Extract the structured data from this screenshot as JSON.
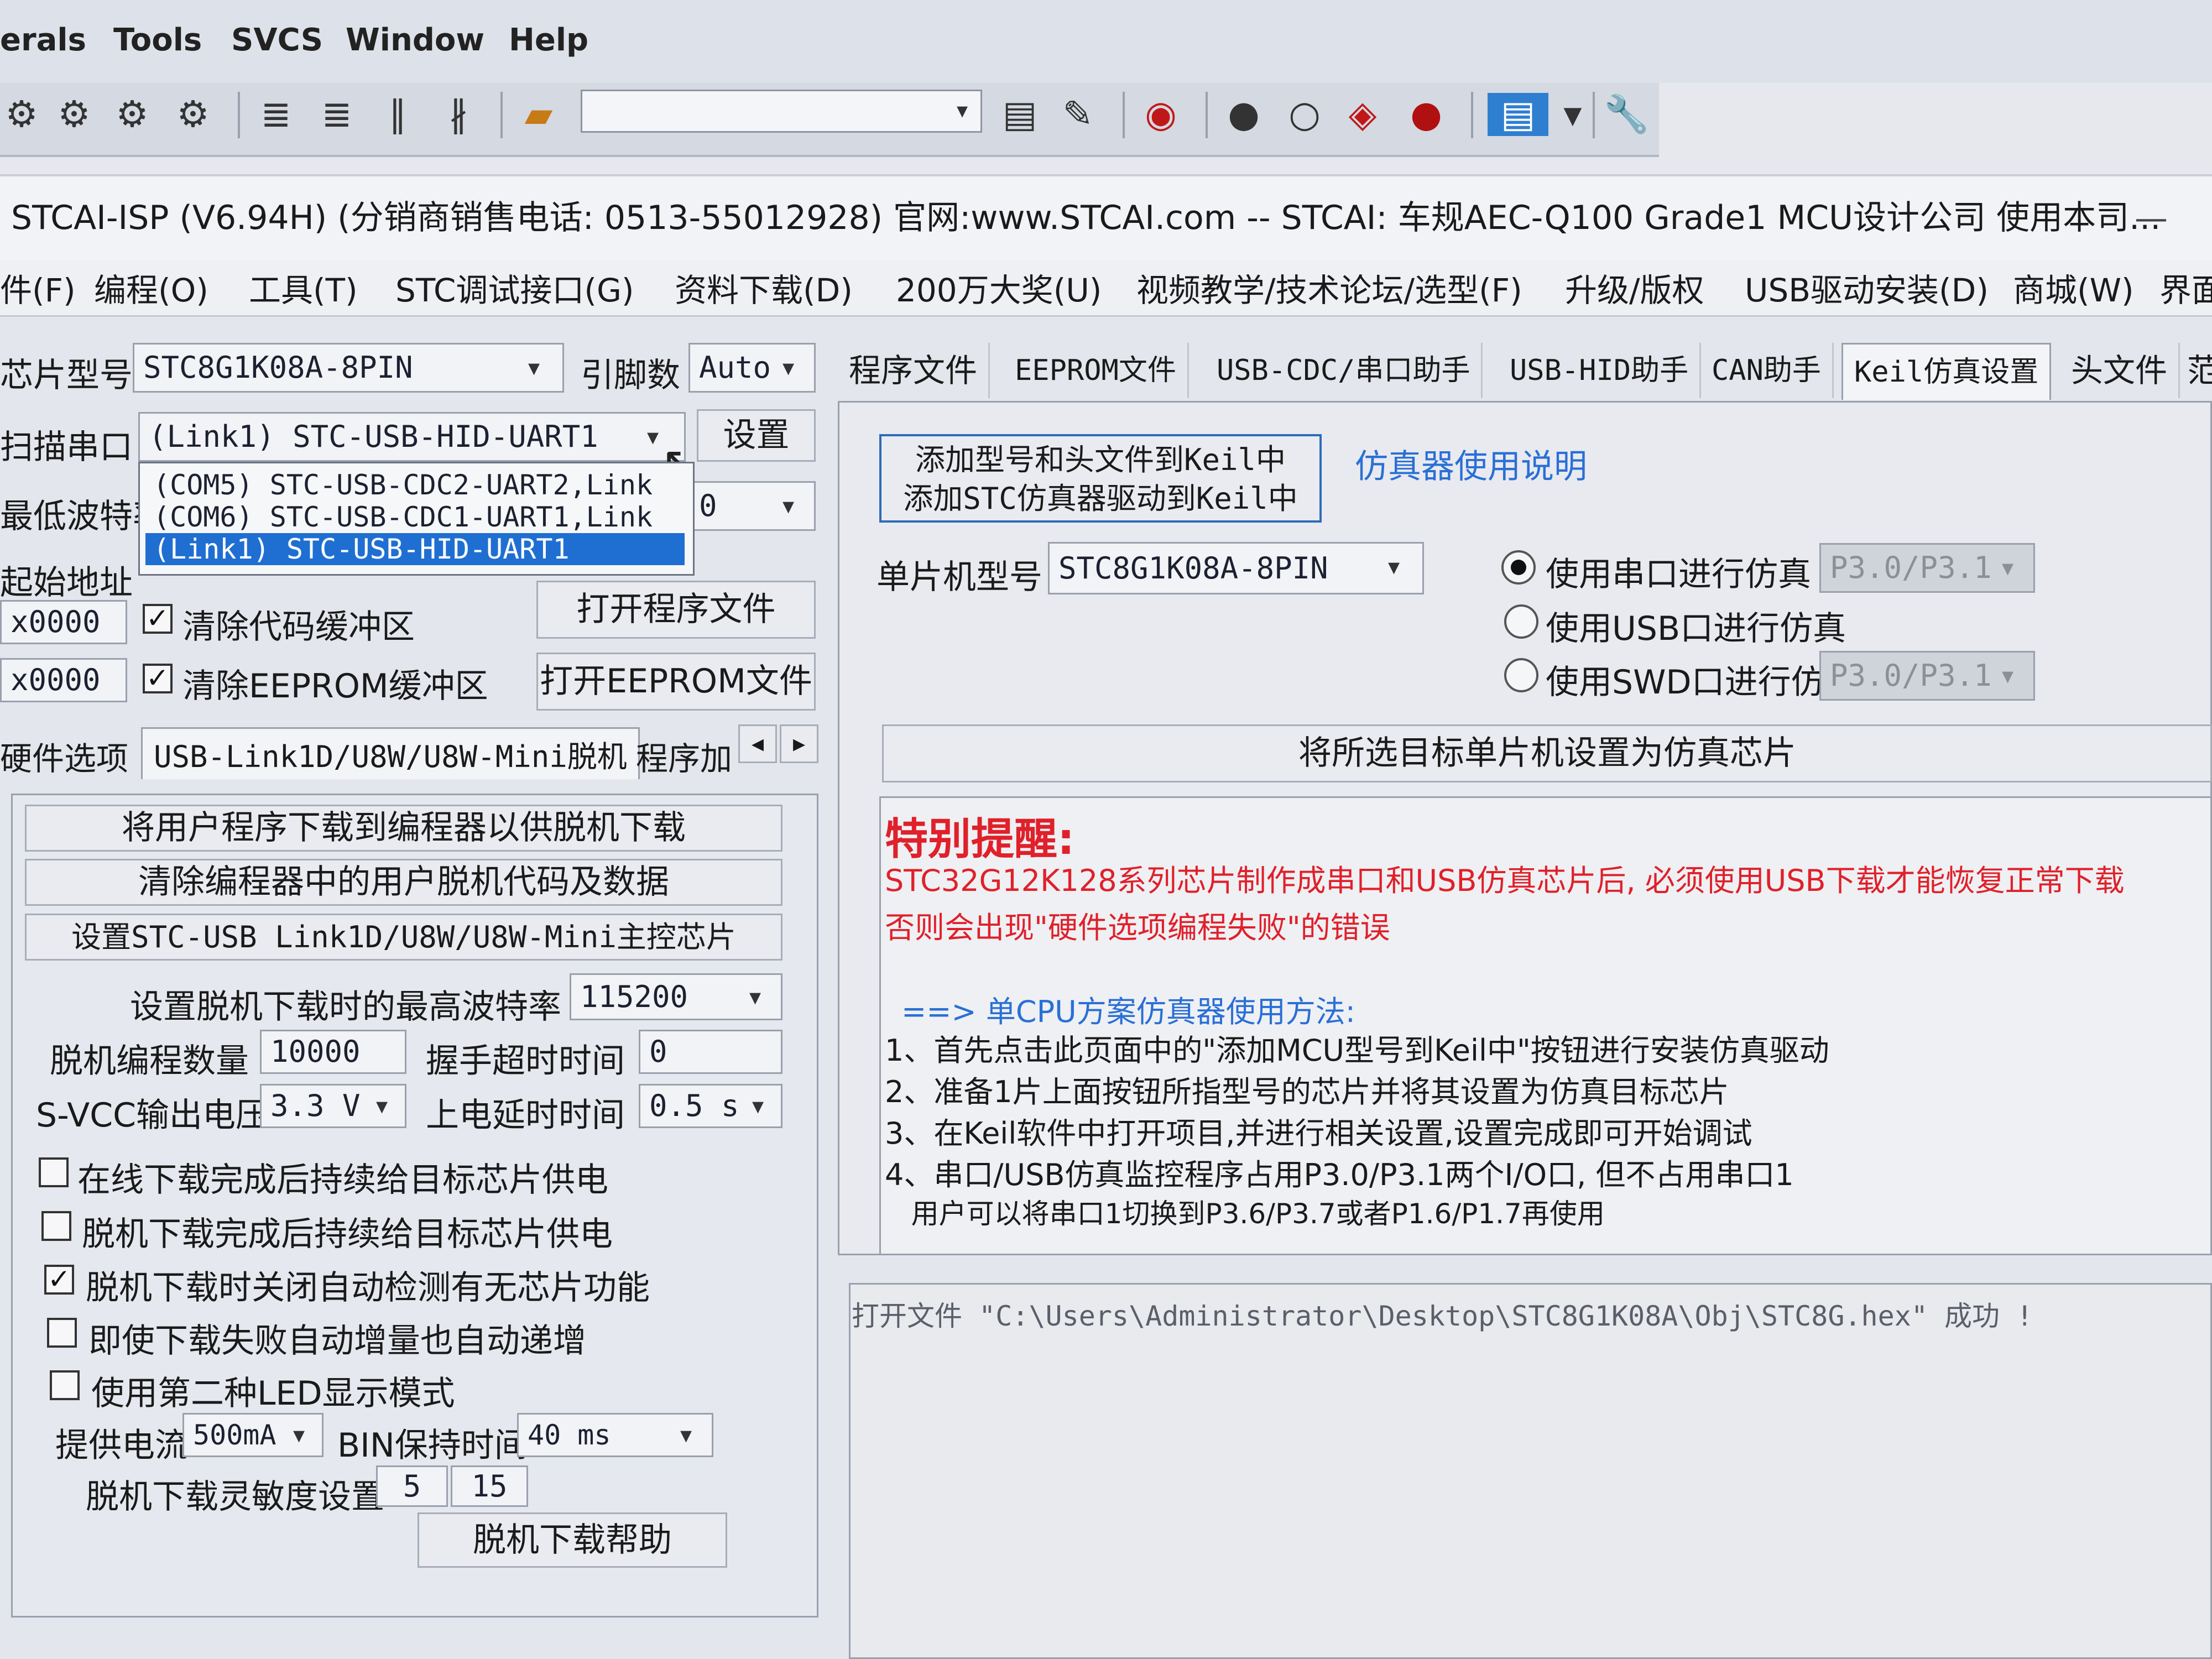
{
  "keil": {
    "menu": [
      "erals",
      "Tools",
      "SVCS",
      "Window",
      "Help"
    ]
  },
  "isp": {
    "title": "STCAI-ISP (V6.94H) (分销商销售电话: 0513-55012928) 官网:www.STCAI.com  -- STCAI: 车规AEC-Q100 Grade1 MCU设计公司 使用本司...",
    "minimize": "—",
    "menubar": [
      "件(F)",
      "编程(O)",
      "工具(T)",
      "STC调试接口(G)",
      "资料下载(D)",
      "200万大奖(U)",
      "视频教学/技术论坛/选型(F)",
      "升级/版权",
      "USB驱动安装(D)",
      "商城(W)",
      "界面"
    ]
  },
  "left": {
    "chip_label": "芯片型号",
    "chip_value": "STC8G1K08A-8PIN",
    "pins_label": "引脚数",
    "pins_value": "Auto",
    "port_label": "扫描串口",
    "port_value": "(Link1) STC-USB-HID-UART1",
    "settings_button": "设置",
    "baud_label": "最低波特率",
    "baud_value_partial": "0",
    "dropdown_options": [
      "(COM5) STC-USB-CDC2-UART2,Link",
      "(COM6) STC-USB-CDC1-UART1,Link",
      "(Link1) STC-USB-HID-UART1"
    ],
    "start_addr_label": "起始地址",
    "addr1": "x0000",
    "addr2": "x0000",
    "clear_code_label": "清除代码缓冲区",
    "clear_eeprom_label": "清除EEPROM缓冲区",
    "open_program_button": "打开程序文件",
    "open_eeprom_button": "打开EEPROM文件",
    "tabs": [
      "硬件选项",
      "USB-Link1D/U8W/U8W-Mini脱机",
      "程序加"
    ],
    "tab_prev": "◂",
    "tab_next": "▸",
    "offline": {
      "btn_download": "将用户程序下载到编程器以供脱机下载",
      "btn_clear": "清除编程器中的用户脱机代码及数据",
      "btn_set_master": "设置STC-USB Link1D/U8W/U8W-Mini主控芯片",
      "max_baud_label": "设置脱机下载时的最高波特率",
      "max_baud_value": "115200",
      "count_label": "脱机编程数量",
      "count_value": "10000",
      "timeout_label": "握手超时时间",
      "timeout_value": "0",
      "svcc_label": "S-VCC输出电压",
      "svcc_value": "3.3 V",
      "delay_label": "上电延时时间",
      "delay_value": "0.5 s",
      "check1": "在线下载完成后持续给目标芯片供电",
      "check2": "脱机下载完成后持续给目标芯片供电",
      "check3": "脱机下载时关闭自动检测有无芯片功能",
      "check4": "即使下载失败自动增量也自动递增",
      "check5": "使用第二种LED显示模式",
      "current_label": "提供电流",
      "current_value": "500mA",
      "bin_label": "BIN保持时间",
      "bin_value": "40 ms",
      "sens_label": "脱机下载灵敏度设置",
      "sens_val1": "5",
      "sens_val2": "15",
      "help_button": "脱机下载帮助"
    }
  },
  "right": {
    "tabs": [
      "程序文件",
      "EEPROM文件",
      "USB-CDC/串口助手",
      "USB-HID助手",
      "CAN助手",
      "Keil仿真设置",
      "头文件",
      "范"
    ],
    "add_button_line1": "添加型号和头文件到Keil中",
    "add_button_line2": "添加STC仿真器驱动到Keil中",
    "emu_help_link": "仿真器使用说明",
    "mcu_label": "单片机型号",
    "mcu_value": "STC8G1K08A-8PIN",
    "radio_serial": "使用串口进行仿真",
    "radio_usb": "使用USB口进行仿真",
    "radio_swd": "使用SWD口进行仿真",
    "serial_pins": "P3.0/P3.1",
    "swd_pins": "P3.0/P3.1",
    "set_target_button": "将所选目标单片机设置为仿真芯片",
    "notice_title": "特别提醒:",
    "notice_line1": "STC32G12K128系列芯片制作成串口和USB仿真芯片后, 必须使用USB下载才能恢复正常下载",
    "notice_line2": "否则会出现\"硬件选项编程失败\"的错误",
    "method_title": "==> 单CPU方案仿真器使用方法:",
    "steps": [
      "1、首先点击此页面中的\"添加MCU型号到Keil中\"按钮进行安装仿真驱动",
      "2、准备1片上面按钮所指型号的芯片并将其设置为仿真目标芯片",
      "3、在Keil软件中打开项目,并进行相关设置,设置完成即可开始调试",
      "4、串口/USB仿真监控程序占用P3.0/P3.1两个I/O口, 但不占用串口1",
      "   用户可以将串口1切换到P3.6/P3.7或者P1.6/P1.7再使用"
    ],
    "log_text": "打开文件 \"C:\\Users\\Administrator\\Desktop\\STC8G1K08A\\Obj\\STC8G.hex\" 成功 !"
  }
}
